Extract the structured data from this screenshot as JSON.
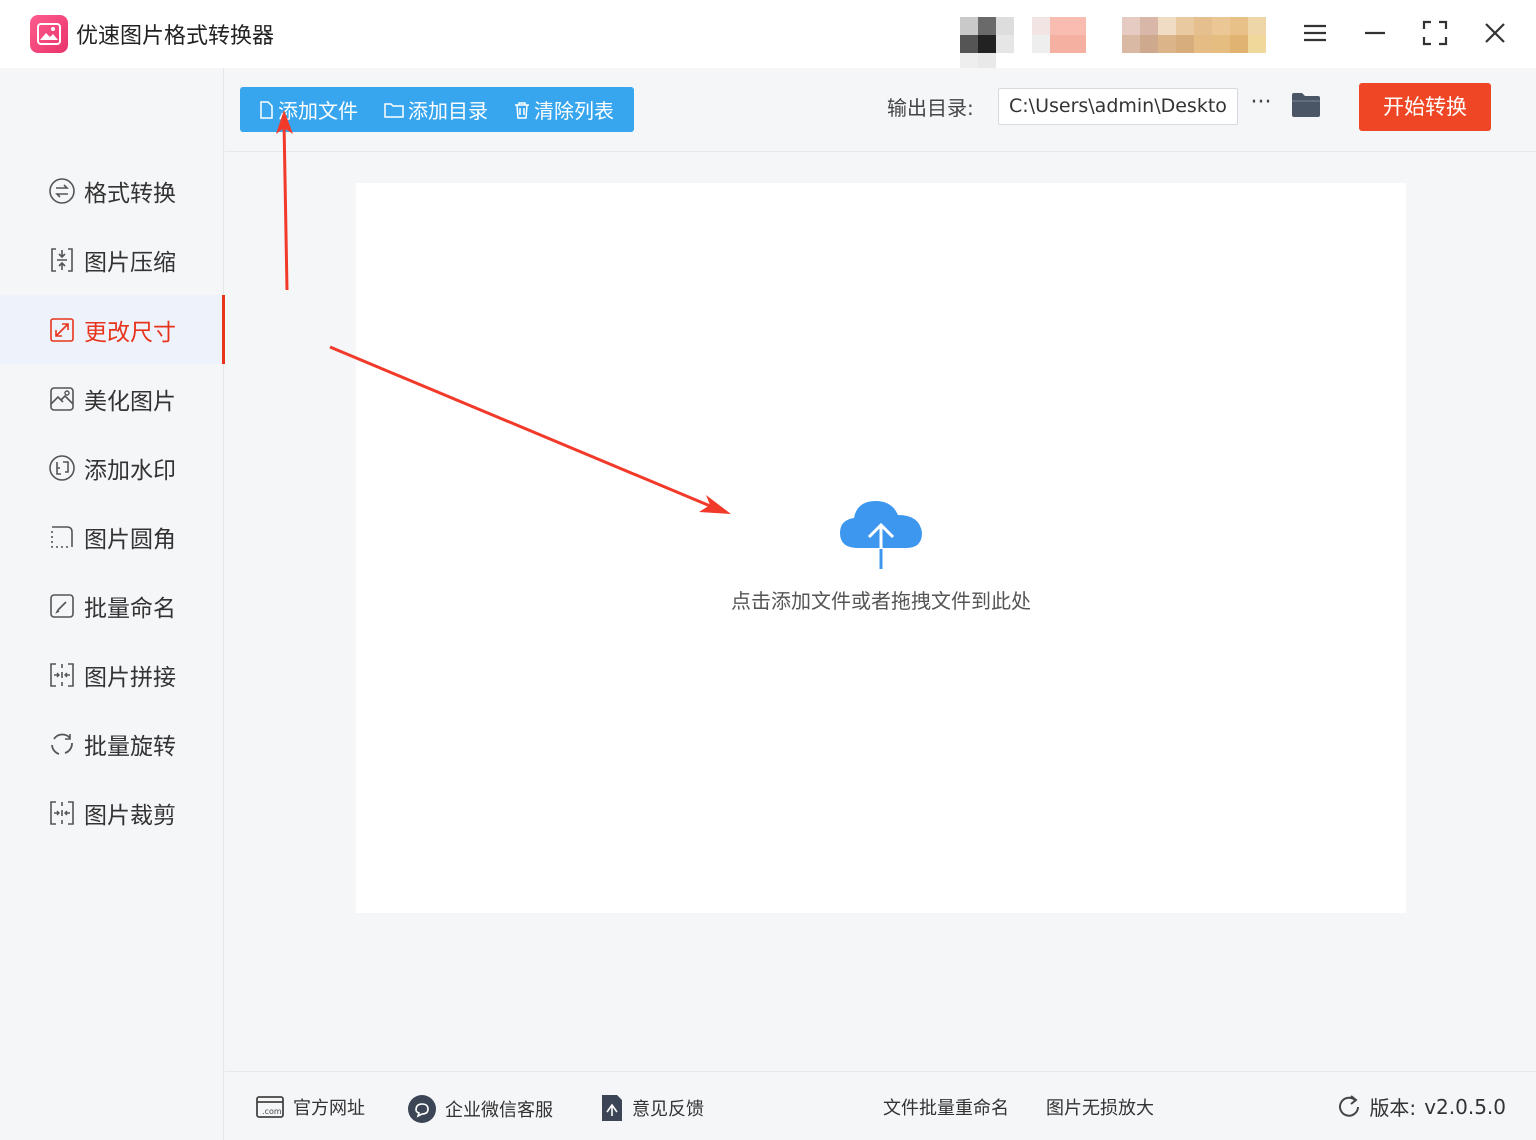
{
  "app": {
    "title": "优速图片格式转换器"
  },
  "sidebar": {
    "items": [
      {
        "label": "格式转换"
      },
      {
        "label": "图片压缩"
      },
      {
        "label": "更改尺寸"
      },
      {
        "label": "美化图片"
      },
      {
        "label": "添加水印"
      },
      {
        "label": "图片圆角"
      },
      {
        "label": "批量命名"
      },
      {
        "label": "图片拼接"
      },
      {
        "label": "批量旋转"
      },
      {
        "label": "图片裁剪"
      }
    ],
    "active_index": 2
  },
  "toolbar": {
    "add_file": "添加文件",
    "add_folder": "添加目录",
    "clear_list": "清除列表",
    "output_label": "输出目录:",
    "output_path": "C:\\Users\\admin\\Deskto",
    "more": "···",
    "start": "开始转换"
  },
  "dropzone": {
    "hint": "点击添加文件或者拖拽文件到此处"
  },
  "footer": {
    "website": "官方网址",
    "wechat": "企业微信客服",
    "feedback": "意见反馈",
    "batch_rename": "文件批量重命名",
    "lossless_zoom": "图片无损放大",
    "version_label": "版本:",
    "version_value": "v2.0.5.0"
  },
  "colors": {
    "accent_blue": "#38a6ef",
    "accent_red": "#ef4726",
    "active_text": "#e8341c",
    "annotation_arrow": "#f23a2a"
  }
}
